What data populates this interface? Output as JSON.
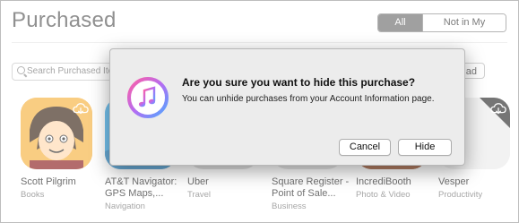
{
  "header": {
    "title": "Purchased",
    "filter_all": "All",
    "filter_not_in_library": "Not in My Library"
  },
  "search": {
    "placeholder": "Search Purchased Item"
  },
  "download_button_partial": "ad",
  "apps": [
    {
      "name": "Scott Pilgrim",
      "category": "Books",
      "icon": "scott-pilgrim-icon",
      "color": "#f2a43a"
    },
    {
      "name": "AT&T Navigator: GPS Maps,...",
      "name_line1": "AT&T Navigator:",
      "name_line2": "GPS Maps,...",
      "category": "Navigation",
      "icon": "att-navigator-icon",
      "color": "#2f9fe0"
    },
    {
      "name": "Uber",
      "category": "Travel",
      "icon": "uber-icon",
      "color": "#cfcfcf"
    },
    {
      "name": "Square Register - Point of Sale...",
      "name_line1": "Square Register -",
      "name_line2": "Point of Sale...",
      "category": "Business",
      "icon": "square-register-icon",
      "color": "#d9d9d9"
    },
    {
      "name": "IncrediBooth",
      "category": "Photo & Video",
      "icon": "incredibooth-icon",
      "color": "#b5571f"
    },
    {
      "name": "Vesper",
      "category": "Productivity",
      "icon": "vesper-icon",
      "color": "#e4e4e4"
    }
  ],
  "dialog": {
    "question": "Are you sure you want to hide this purchase?",
    "message": "You can unhide purchases from your Account Information page.",
    "cancel_label": "Cancel",
    "hide_label": "Hide",
    "icon": "itunes-icon"
  }
}
